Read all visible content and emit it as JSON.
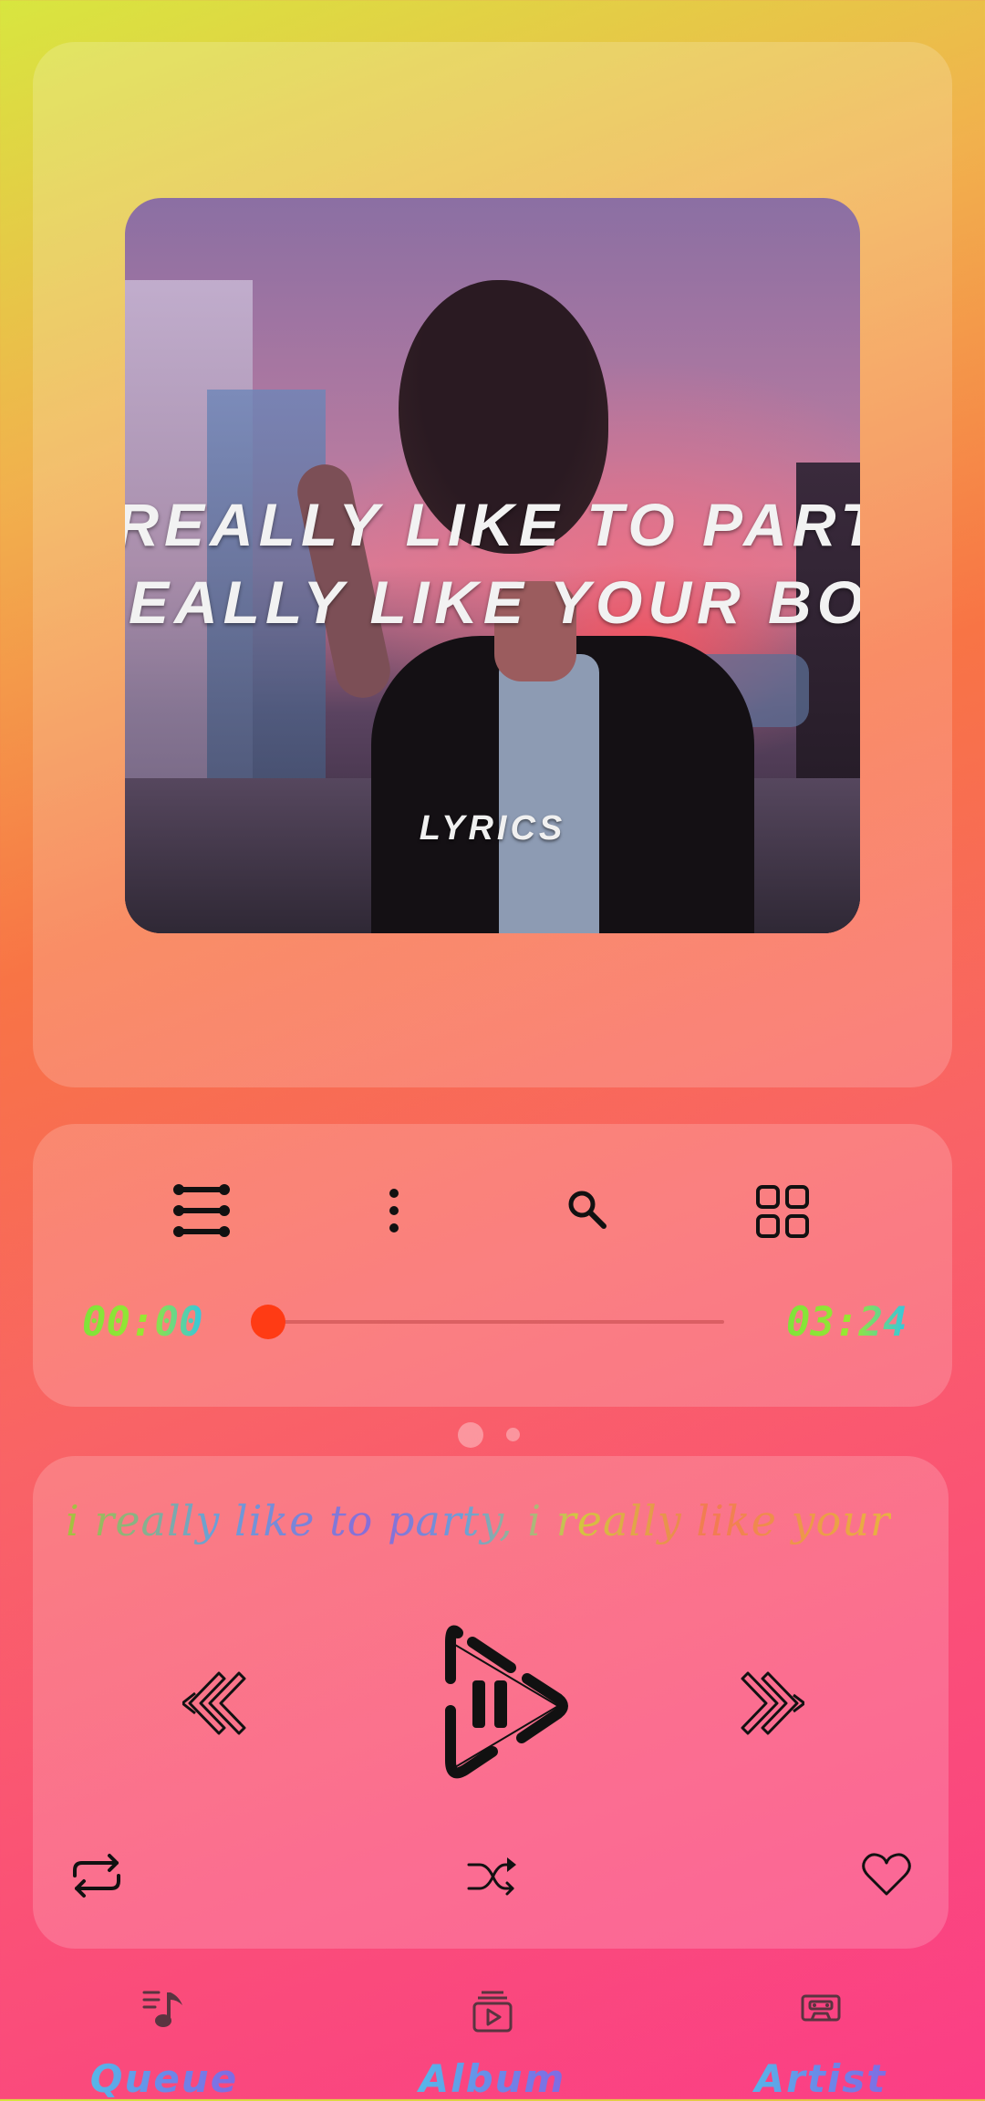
{
  "artwork": {
    "line1": "REALLY LIKE TO PART",
    "line2": "EALLY LIKE YOUR BO",
    "caption": "LYRICS"
  },
  "controls": {
    "icons": [
      "queue-list-icon",
      "more-vert-icon",
      "search-icon",
      "grid-icon"
    ]
  },
  "progress": {
    "current_time": "00:00",
    "total_time": "03:24",
    "fraction": 0
  },
  "pager": {
    "pages": 2,
    "active": 1
  },
  "lyrics": {
    "current_line": "i really like to party, i really like your"
  },
  "player": {
    "state": "playing",
    "icons": [
      "rewind-icon",
      "play-pause-icon",
      "fast-forward-icon",
      "repeat-icon",
      "shuffle-icon",
      "heart-icon"
    ]
  },
  "nav": {
    "queue": "Queue",
    "album": "Album",
    "artist": "Artist"
  }
}
